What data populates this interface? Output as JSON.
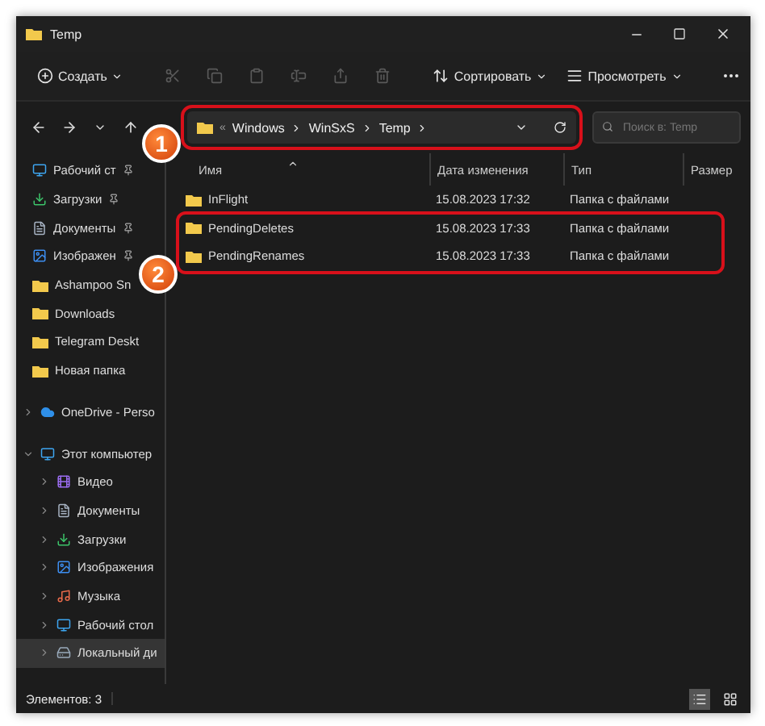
{
  "window": {
    "title": "Temp"
  },
  "toolbar": [
    {
      "kind": "new",
      "label": "Создать",
      "disabled": false
    },
    {
      "kind": "cut",
      "disabled": true
    },
    {
      "kind": "copy",
      "disabled": true
    },
    {
      "kind": "paste",
      "disabled": true
    },
    {
      "kind": "rename",
      "disabled": true
    },
    {
      "kind": "share",
      "disabled": true
    },
    {
      "kind": "delete",
      "disabled": true
    },
    {
      "kind": "sort",
      "label": "Сортировать",
      "disabled": false
    },
    {
      "kind": "view",
      "label": "Просмотреть",
      "disabled": false
    },
    {
      "kind": "more",
      "disabled": false
    }
  ],
  "address_bar": {
    "callout": "1",
    "overflow": "«",
    "path": [
      "Windows",
      "WinSxS",
      "Temp"
    ]
  },
  "search": {
    "placeholder": "Поиск в: Temp"
  },
  "sidebar": {
    "quick_access": [
      {
        "label": "Рабочий ст",
        "kind": "desktop",
        "pinned": true
      },
      {
        "label": "Загрузки",
        "kind": "downloads",
        "pinned": true
      },
      {
        "label": "Документы",
        "kind": "documents",
        "pinned": true
      },
      {
        "label": "Изображен",
        "kind": "pictures",
        "pinned": true
      },
      {
        "label": "Ashampoo Sn",
        "kind": "folder",
        "pinned": false
      },
      {
        "label": "Downloads",
        "kind": "folder",
        "pinned": false
      },
      {
        "label": "Telegram Deskt",
        "kind": "folder",
        "pinned": false
      },
      {
        "label": "Новая папка",
        "kind": "folder",
        "pinned": false
      }
    ],
    "tree": [
      {
        "label": "OneDrive - Perso",
        "kind": "cloud",
        "expanded": false,
        "selected": false
      },
      {
        "label": "Этот компьютер",
        "kind": "computer",
        "expanded": true,
        "selected": false,
        "children": [
          {
            "label": "Видео",
            "kind": "video",
            "expanded": false,
            "selected": false
          },
          {
            "label": "Документы",
            "kind": "documents",
            "expanded": false,
            "selected": false
          },
          {
            "label": "Загрузки",
            "kind": "downloads",
            "expanded": false,
            "selected": false
          },
          {
            "label": "Изображения",
            "kind": "pictures",
            "expanded": false,
            "selected": false
          },
          {
            "label": "Музыка",
            "kind": "music",
            "expanded": false,
            "selected": false
          },
          {
            "label": "Рабочий стол",
            "kind": "desktop",
            "expanded": false,
            "selected": false
          },
          {
            "label": "Локальный ди",
            "kind": "drive",
            "expanded": false,
            "selected": true
          }
        ]
      }
    ]
  },
  "table": {
    "callout": "2",
    "columns": [
      {
        "label": "Имя",
        "sorted": true
      },
      {
        "label": "Дата изменения",
        "sorted": false
      },
      {
        "label": "Тип",
        "sorted": false
      },
      {
        "label": "Размер",
        "sorted": false
      }
    ],
    "rows": [
      {
        "name": "InFlight",
        "date": "15.08.2023 17:32",
        "type": "Папка с файлами",
        "highlighted": false
      },
      {
        "name": "PendingDeletes",
        "date": "15.08.2023 17:33",
        "type": "Папка с файлами",
        "highlighted": true
      },
      {
        "name": "PendingRenames",
        "date": "15.08.2023 17:33",
        "type": "Папка с файлами",
        "highlighted": true
      }
    ]
  },
  "status_bar": {
    "text": "Элементов: 3",
    "views": [
      {
        "kind": "details",
        "selected": true
      },
      {
        "kind": "tiles",
        "selected": false
      }
    ]
  }
}
